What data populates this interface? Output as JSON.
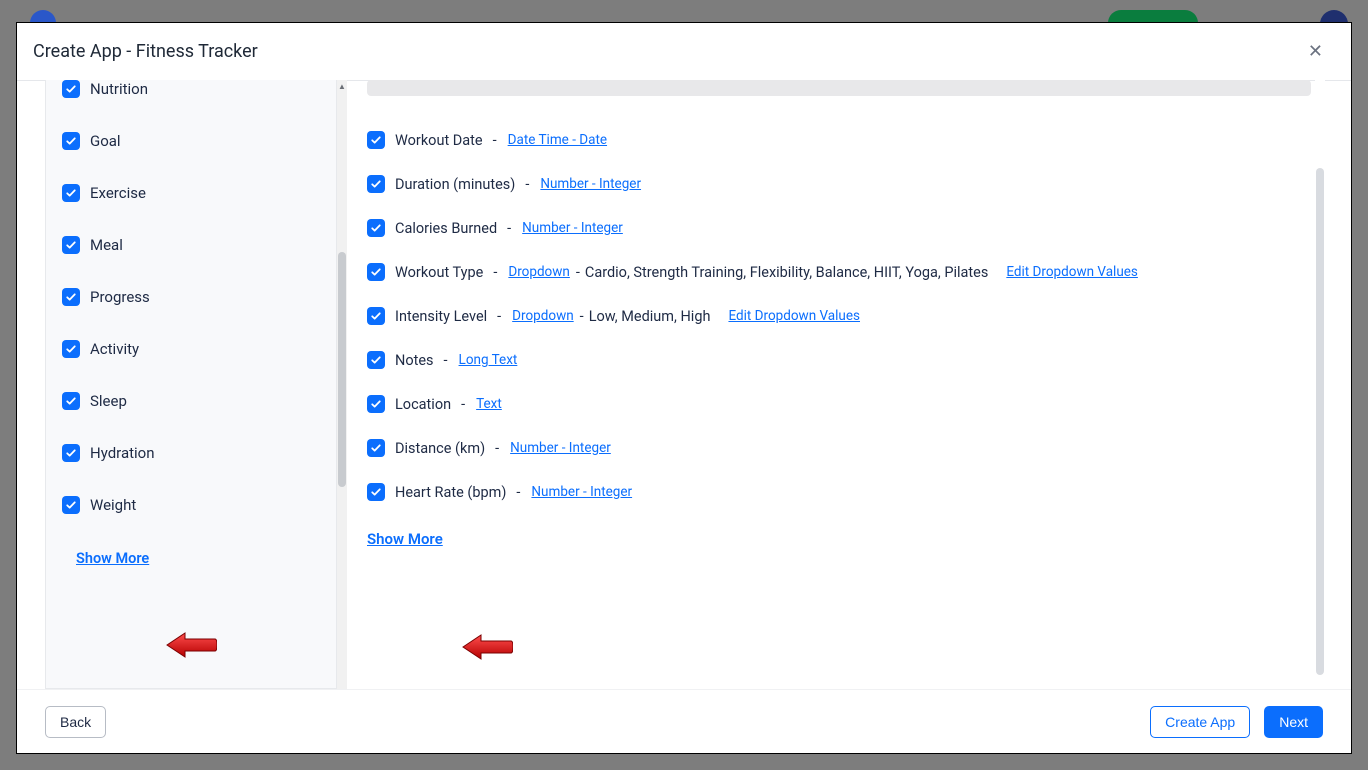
{
  "modal": {
    "title": "Create App - Fitness Tracker"
  },
  "sidebar": {
    "items": [
      {
        "label": "Nutrition"
      },
      {
        "label": "Goal"
      },
      {
        "label": "Exercise"
      },
      {
        "label": "Meal"
      },
      {
        "label": "Progress"
      },
      {
        "label": "Activity"
      },
      {
        "label": "Sleep"
      },
      {
        "label": "Hydration"
      },
      {
        "label": "Weight"
      }
    ],
    "show_more": "Show More"
  },
  "fields": [
    {
      "name": "Workout Date",
      "type": "Date Time - Date"
    },
    {
      "name": "Duration (minutes)",
      "type": "Number - Integer"
    },
    {
      "name": "Calories Burned",
      "type": "Number - Integer"
    },
    {
      "name": "Workout Type",
      "type": "Dropdown",
      "extras": "Cardio, Strength Training, Flexibility, Balance, HIIT, Yoga, Pilates",
      "edit": "Edit Dropdown Values"
    },
    {
      "name": "Intensity Level",
      "type": "Dropdown",
      "extras": "Low, Medium, High",
      "edit": "Edit Dropdown Values"
    },
    {
      "name": "Notes",
      "type": "Long Text"
    },
    {
      "name": "Location",
      "type": "Text"
    },
    {
      "name": "Distance (km)",
      "type": "Number - Integer"
    },
    {
      "name": "Heart Rate (bpm)",
      "type": "Number - Integer"
    }
  ],
  "main": {
    "show_more": "Show More"
  },
  "footer": {
    "back": "Back",
    "create": "Create App",
    "next": "Next"
  }
}
